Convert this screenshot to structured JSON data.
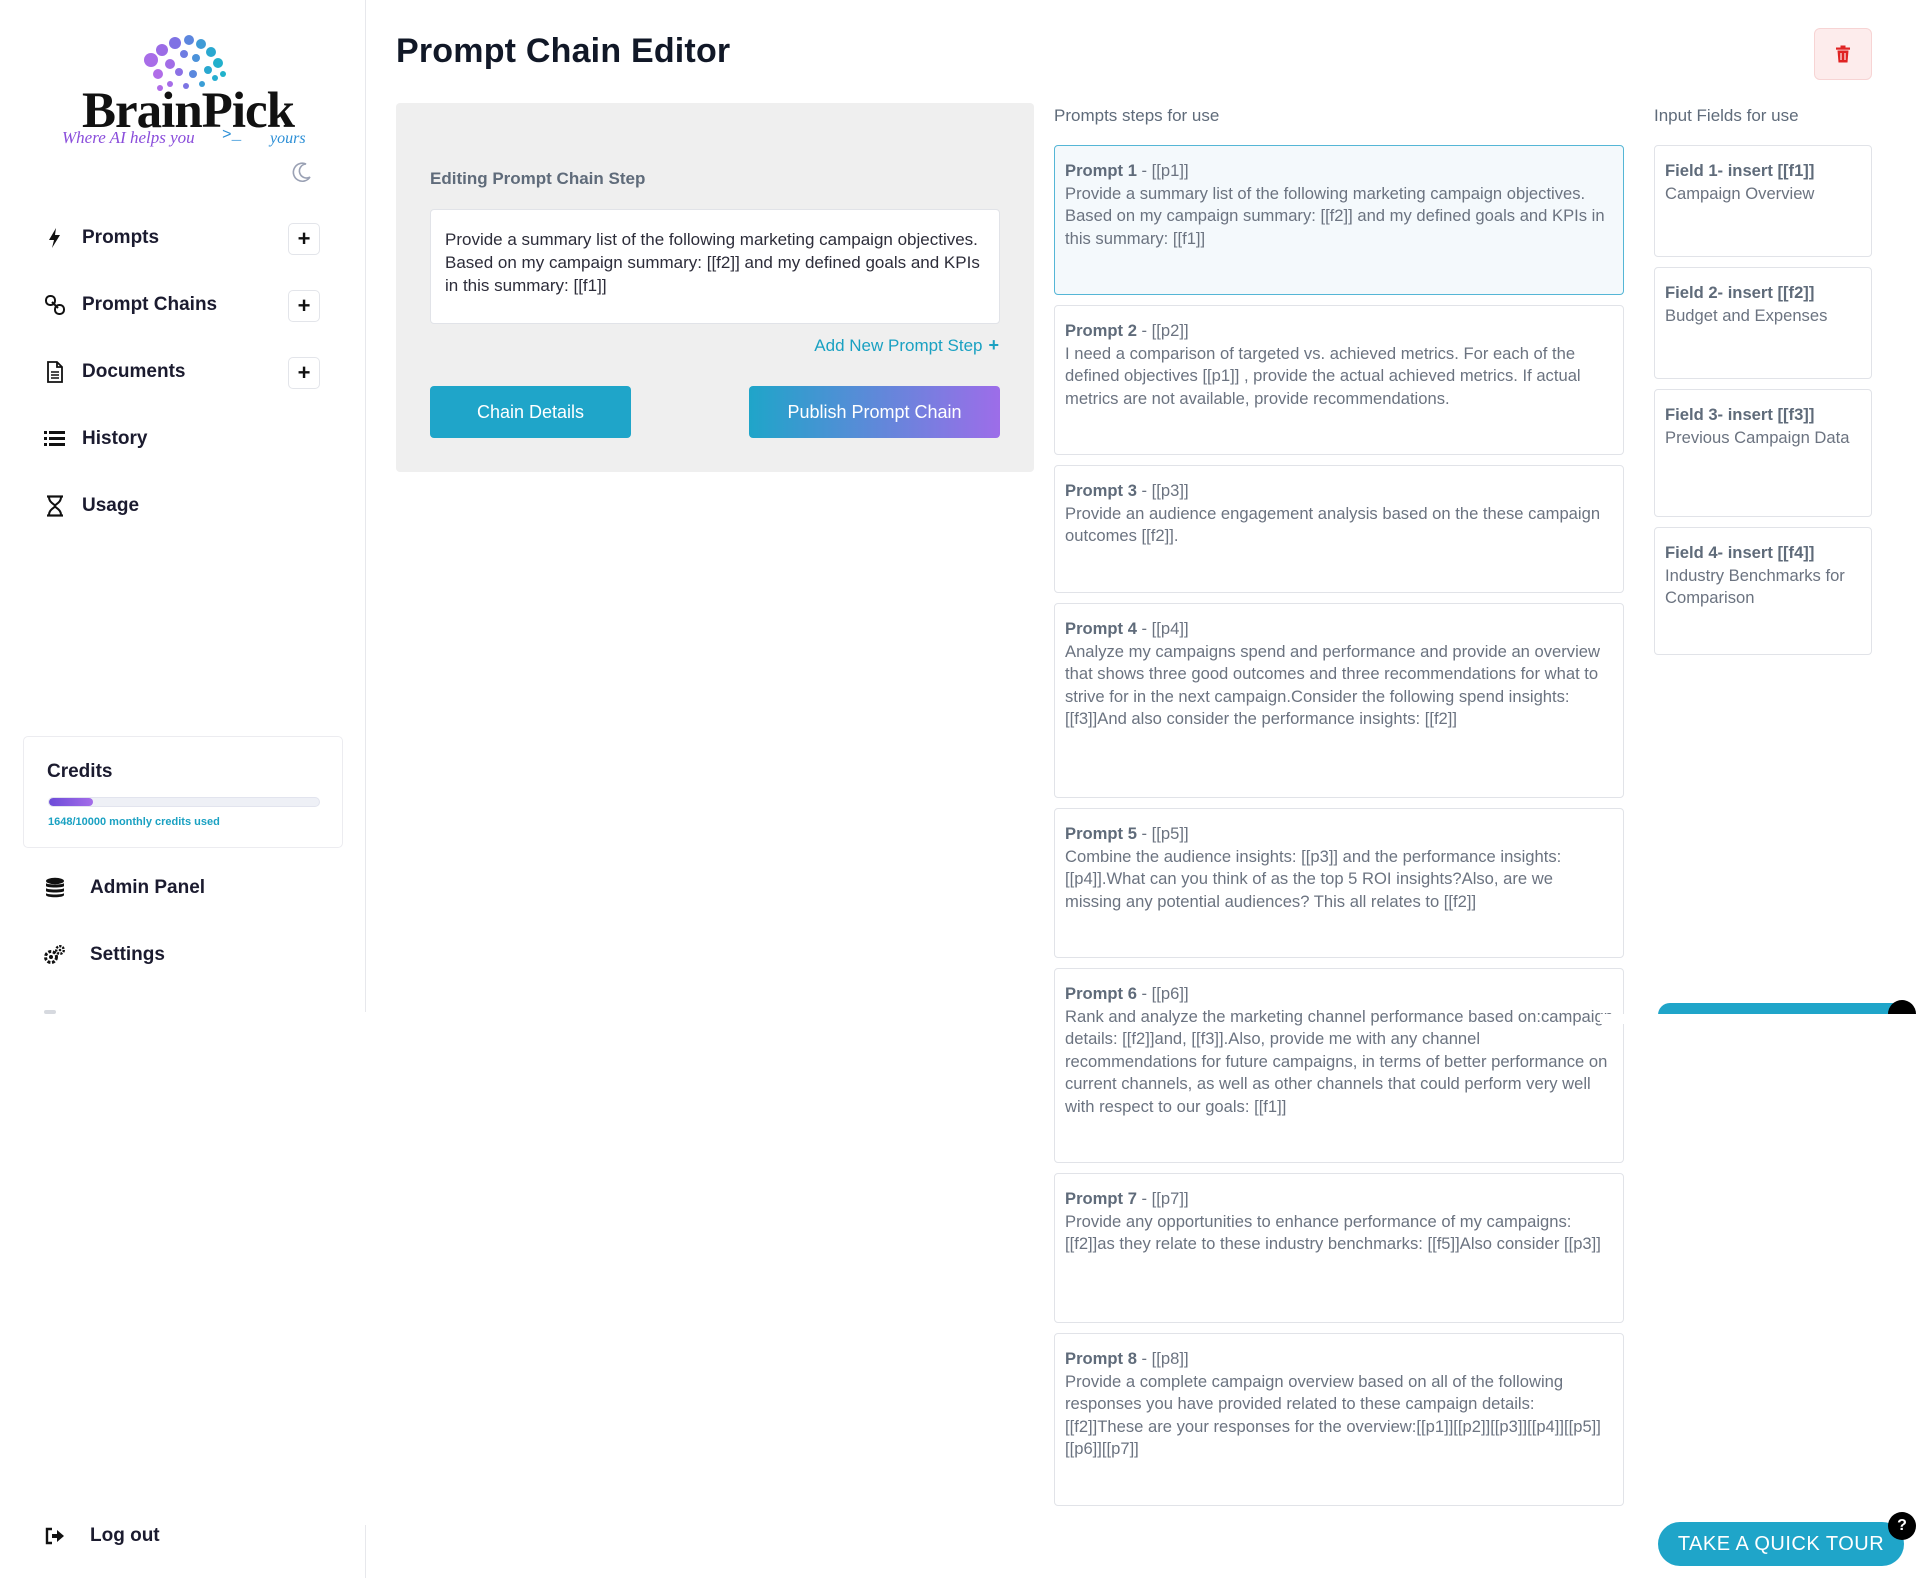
{
  "brand": {
    "name": "BrainPick",
    "tagline": "Where AI helps you",
    "prompt_symbol": ">_",
    "tagline_end": "yours"
  },
  "sidebar": {
    "items": [
      {
        "label": "Prompts",
        "icon": "bolt-icon",
        "has_add": true
      },
      {
        "label": "Prompt Chains",
        "icon": "link-icon",
        "has_add": true
      },
      {
        "label": "Documents",
        "icon": "document-icon",
        "has_add": true
      },
      {
        "label": "History",
        "icon": "list-icon",
        "has_add": false
      },
      {
        "label": "Usage",
        "icon": "hourglass-icon",
        "has_add": false
      }
    ],
    "add_symbol": "+",
    "credits": {
      "title": "Credits",
      "used": 1648,
      "total": 10000,
      "fraction_used": 0.1648,
      "summary": "1648/10000 monthly credits used"
    },
    "admin_label": "Admin Panel",
    "settings_label": "Settings",
    "logout_label": "Log out"
  },
  "main": {
    "title": "Prompt Chain Editor",
    "editor": {
      "label": "Editing Prompt Chain Step",
      "text": "Provide a summary list of the following marketing campaign objectives. Based on my campaign summary: [[f2]] and my defined goals and KPIs in this summary: [[f1]]",
      "add_step_label": "Add New Prompt Step",
      "chain_details_label": "Chain Details",
      "publish_label": "Publish Prompt Chain"
    },
    "prompts_heading": "Prompts steps for use",
    "fields_heading": "Input Fields for use",
    "prompts": [
      {
        "title": "Prompt 1",
        "ref": " - [[p1]]",
        "text": "Provide a summary list of the following marketing campaign objectives. Based on my campaign summary: [[f2]] and my defined goals and KPIs in this summary: [[f1]]"
      },
      {
        "title": "Prompt 2",
        "ref": " - [[p2]]",
        "text": "I need a comparison of targeted vs. achieved metrics. For each of the defined objectives [[p1]] , provide the actual achieved metrics. If actual metrics are not available, provide recommendations."
      },
      {
        "title": "Prompt 3",
        "ref": " - [[p3]]",
        "text": "Provide an audience engagement analysis based on the these campaign outcomes [[f2]]."
      },
      {
        "title": "Prompt 4",
        "ref": " - [[p4]]",
        "text": "Analyze my campaigns spend and performance and provide an overview that shows three good outcomes and three recommendations for what to strive for in the next campaign.Consider the following spend insights: [[f3]]And also consider the performance insights: [[f2]]"
      },
      {
        "title": "Prompt 5",
        "ref": " - [[p5]]",
        "text": "Combine the audience insights: [[p3]] and the performance insights: [[p4]].What can you think of as the top 5 ROI insights?Also, are we missing any potential audiences? This all relates to [[f2]]"
      },
      {
        "title": "Prompt 6",
        "ref": " - [[p6]]",
        "text": "Rank and analyze the marketing channel performance based on:campaign details: [[f2]]and, [[f3]].Also, provide me with any channel recommendations for future campaigns, in terms of better performance on current channels, as well as other channels that could perform very well with respect to our goals: [[f1]]"
      },
      {
        "title": "Prompt 7",
        "ref": " - [[p7]]",
        "text": "Provide any opportunities to enhance performance of my campaigns: [[f2]]as they relate to these industry benchmarks: [[f5]]Also consider [[p3]]"
      },
      {
        "title": "Prompt 8",
        "ref": " - [[p8]]",
        "text": "Provide a complete campaign overview based on all of the following responses you have provided related to these campaign details: [[f2]]These are your responses for the overview:[[p1]][[p2]][[p3]][[p4]][[p5]][[p6]][[p7]]"
      }
    ],
    "fields": [
      {
        "title": "Field 1- insert [[f1]]",
        "text": "Campaign Overview"
      },
      {
        "title": "Field 2- insert [[f2]]",
        "text": "Budget and Expenses"
      },
      {
        "title": "Field 3- insert [[f3]]",
        "text": "Previous Campaign Data"
      },
      {
        "title": "Field 4- insert [[f4]]",
        "text": "Industry Benchmarks for Comparison"
      }
    ]
  },
  "tour": {
    "label": "TAKE A QUICK TOUR",
    "badge": "?"
  },
  "colors": {
    "accent": "#1fa5c9",
    "purple": "#9d6de9",
    "danger": "#e02424"
  }
}
